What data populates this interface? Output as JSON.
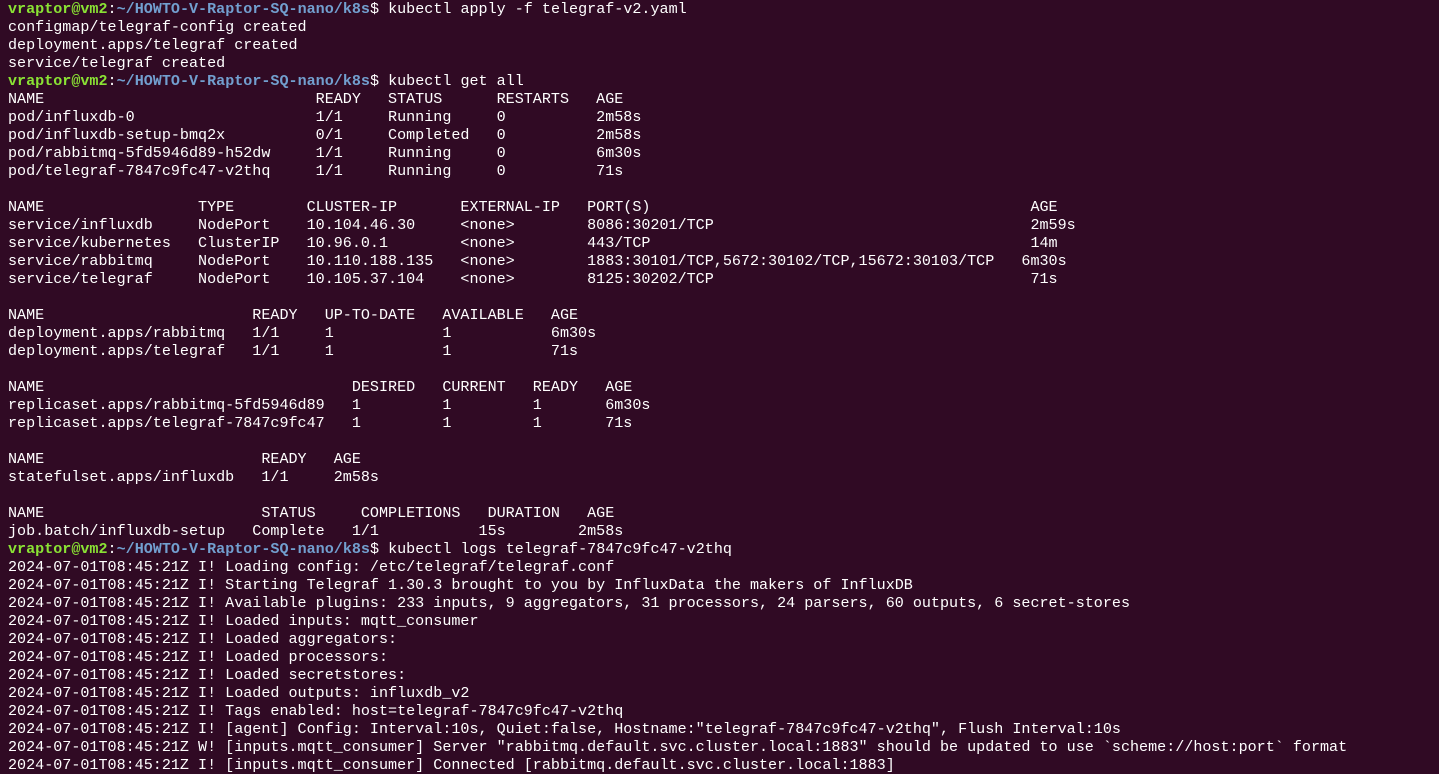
{
  "prompt": {
    "user_host": "vraptor@vm2",
    "separator": ":",
    "path": "~/HOWTO-V-Raptor-SQ-nano/k8s",
    "symbol": "$ "
  },
  "colors": {
    "background": "#300a24",
    "foreground": "#ffffff",
    "prompt_user": "#8ae234",
    "prompt_path": "#729fcf"
  },
  "commands": [
    "kubectl apply -f telegraf-v2.yaml",
    "kubectl get all",
    "kubectl logs telegraf-7847c9fc47-v2thq"
  ],
  "apply_output": [
    "configmap/telegraf-config created",
    "deployment.apps/telegraf created",
    "service/telegraf created"
  ],
  "get_all_output": [
    "NAME                              READY   STATUS      RESTARTS   AGE",
    "pod/influxdb-0                    1/1     Running     0          2m58s",
    "pod/influxdb-setup-bmq2x          0/1     Completed   0          2m58s",
    "pod/rabbitmq-5fd5946d89-h52dw     1/1     Running     0          6m30s",
    "pod/telegraf-7847c9fc47-v2thq     1/1     Running     0          71s",
    "",
    "NAME                 TYPE        CLUSTER-IP       EXTERNAL-IP   PORT(S)                                          AGE",
    "service/influxdb     NodePort    10.104.46.30     <none>        8086:30201/TCP                                   2m59s",
    "service/kubernetes   ClusterIP   10.96.0.1        <none>        443/TCP                                          14m",
    "service/rabbitmq     NodePort    10.110.188.135   <none>        1883:30101/TCP,5672:30102/TCP,15672:30103/TCP   6m30s",
    "service/telegraf     NodePort    10.105.37.104    <none>        8125:30202/TCP                                   71s",
    "",
    "NAME                       READY   UP-TO-DATE   AVAILABLE   AGE",
    "deployment.apps/rabbitmq   1/1     1            1           6m30s",
    "deployment.apps/telegraf   1/1     1            1           71s",
    "",
    "NAME                                  DESIRED   CURRENT   READY   AGE",
    "replicaset.apps/rabbitmq-5fd5946d89   1         1         1       6m30s",
    "replicaset.apps/telegraf-7847c9fc47   1         1         1       71s",
    "",
    "NAME                        READY   AGE",
    "statefulset.apps/influxdb   1/1     2m58s",
    "",
    "NAME                        STATUS     COMPLETIONS   DURATION   AGE",
    "job.batch/influxdb-setup   Complete   1/1           15s        2m58s"
  ],
  "logs_output": [
    "2024-07-01T08:45:21Z I! Loading config: /etc/telegraf/telegraf.conf",
    "2024-07-01T08:45:21Z I! Starting Telegraf 1.30.3 brought to you by InfluxData the makers of InfluxDB",
    "2024-07-01T08:45:21Z I! Available plugins: 233 inputs, 9 aggregators, 31 processors, 24 parsers, 60 outputs, 6 secret-stores",
    "2024-07-01T08:45:21Z I! Loaded inputs: mqtt_consumer",
    "2024-07-01T08:45:21Z I! Loaded aggregators:",
    "2024-07-01T08:45:21Z I! Loaded processors:",
    "2024-07-01T08:45:21Z I! Loaded secretstores:",
    "2024-07-01T08:45:21Z I! Loaded outputs: influxdb_v2",
    "2024-07-01T08:45:21Z I! Tags enabled: host=telegraf-7847c9fc47-v2thq",
    "2024-07-01T08:45:21Z I! [agent] Config: Interval:10s, Quiet:false, Hostname:\"telegraf-7847c9fc47-v2thq\", Flush Interval:10s",
    "2024-07-01T08:45:21Z W! [inputs.mqtt_consumer] Server \"rabbitmq.default.svc.cluster.local:1883\" should be updated to use `scheme://host:port` format",
    "2024-07-01T08:45:21Z I! [inputs.mqtt_consumer] Connected [rabbitmq.default.svc.cluster.local:1883]"
  ]
}
